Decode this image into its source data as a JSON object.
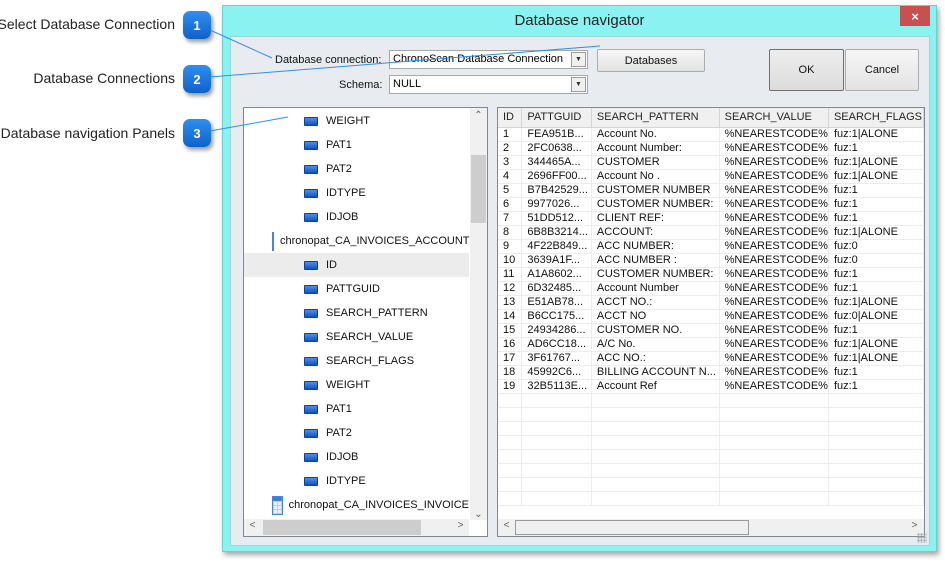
{
  "callouts": [
    {
      "number": "1",
      "label": "Select Database Connection"
    },
    {
      "number": "2",
      "label": "Database Connections"
    },
    {
      "number": "3",
      "label": "Database navigation Panels"
    }
  ],
  "window": {
    "title": "Database navigator",
    "close_icon": "×"
  },
  "form": {
    "connection_label": "Database connection:",
    "connection_value": "ChronoScan Database Connection",
    "schema_label": "Schema:",
    "schema_value": "NULL",
    "databases_button": "Databases",
    "ok_button": "OK",
    "cancel_button": "Cancel",
    "dropdown_arrow": "▼"
  },
  "tree": {
    "items": [
      {
        "type": "column",
        "label": "WEIGHT"
      },
      {
        "type": "column",
        "label": "PAT1"
      },
      {
        "type": "column",
        "label": "PAT2"
      },
      {
        "type": "column",
        "label": "IDTYPE"
      },
      {
        "type": "column",
        "label": "IDJOB"
      },
      {
        "type": "table",
        "label": "chronopat_CA_INVOICES_ACCOUNT"
      },
      {
        "type": "column",
        "label": "ID",
        "selected": true
      },
      {
        "type": "column",
        "label": "PATTGUID"
      },
      {
        "type": "column",
        "label": "SEARCH_PATTERN"
      },
      {
        "type": "column",
        "label": "SEARCH_VALUE"
      },
      {
        "type": "column",
        "label": "SEARCH_FLAGS"
      },
      {
        "type": "column",
        "label": "WEIGHT"
      },
      {
        "type": "column",
        "label": "PAT1"
      },
      {
        "type": "column",
        "label": "PAT2"
      },
      {
        "type": "column",
        "label": "IDJOB"
      },
      {
        "type": "column",
        "label": "IDTYPE"
      },
      {
        "type": "table",
        "label": "chronopat_CA_INVOICES_INVOICE"
      }
    ],
    "scroll_up": "⌃",
    "scroll_down": "⌄",
    "scroll_left": "<",
    "scroll_right": ">"
  },
  "grid": {
    "columns": [
      "ID",
      "PATTGUID",
      "SEARCH_PATTERN",
      "SEARCH_VALUE",
      "SEARCH_FLAGS"
    ],
    "rows": [
      [
        "1",
        "FEA951B...",
        "Account No.",
        "%NEARESTCODE%",
        "fuz:1|ALONE"
      ],
      [
        "2",
        "2FC0638...",
        "Account Number:",
        "%NEARESTCODE%",
        "fuz:1"
      ],
      [
        "3",
        "344465A...",
        "CUSTOMER",
        "%NEARESTCODE%",
        "fuz:1|ALONE"
      ],
      [
        "4",
        "2696FF00...",
        "Account No .",
        "%NEARESTCODE%",
        "fuz:1|ALONE"
      ],
      [
        "5",
        "B7B42529...",
        "CUSTOMER NUMBER",
        "%NEARESTCODE%",
        "fuz:1"
      ],
      [
        "6",
        "9977026...",
        "CUSTOMER NUMBER:",
        "%NEARESTCODE%",
        "fuz:1"
      ],
      [
        "7",
        "51DD512...",
        "CLIENT REF:",
        "%NEARESTCODE%",
        "fuz:1"
      ],
      [
        "8",
        "6B8B3214...",
        "ACCOUNT:",
        "%NEARESTCODE%",
        "fuz:1|ALONE"
      ],
      [
        "9",
        "4F22B849...",
        "ACC NUMBER:",
        "%NEARESTCODE%",
        "fuz:0"
      ],
      [
        "10",
        "3639A1F...",
        "ACC NUMBER :",
        "%NEARESTCODE%",
        "fuz:0"
      ],
      [
        "11",
        "A1A8602...",
        "CUSTOMER NUMBER:",
        "%NEARESTCODE%",
        "fuz:1"
      ],
      [
        "12",
        "6D32485...",
        "Account Number",
        "%NEARESTCODE%",
        "fuz:1"
      ],
      [
        "13",
        "E51AB78...",
        "ACCT NO.:",
        "%NEARESTCODE%",
        "fuz:1|ALONE"
      ],
      [
        "14",
        "B6CC175...",
        "ACCT NO",
        "%NEARESTCODE%",
        "fuz:0|ALONE"
      ],
      [
        "15",
        "24934286...",
        "CUSTOMER NO.",
        "%NEARESTCODE%",
        "fuz:1"
      ],
      [
        "16",
        "AD6CC18...",
        "A/C No.",
        "%NEARESTCODE%",
        "fuz:1|ALONE"
      ],
      [
        "17",
        "3F61767...",
        "ACC NO.:",
        "%NEARESTCODE%",
        "fuz:1|ALONE"
      ],
      [
        "18",
        "45992C6...",
        "BILLING ACCOUNT N...",
        "%NEARESTCODE%",
        "fuz:1"
      ],
      [
        "19",
        "32B5113E...",
        "Account Ref",
        "%NEARESTCODE%",
        "fuz:1"
      ]
    ],
    "empty_rows": 8,
    "scroll_left": "<",
    "scroll_right": ">"
  }
}
